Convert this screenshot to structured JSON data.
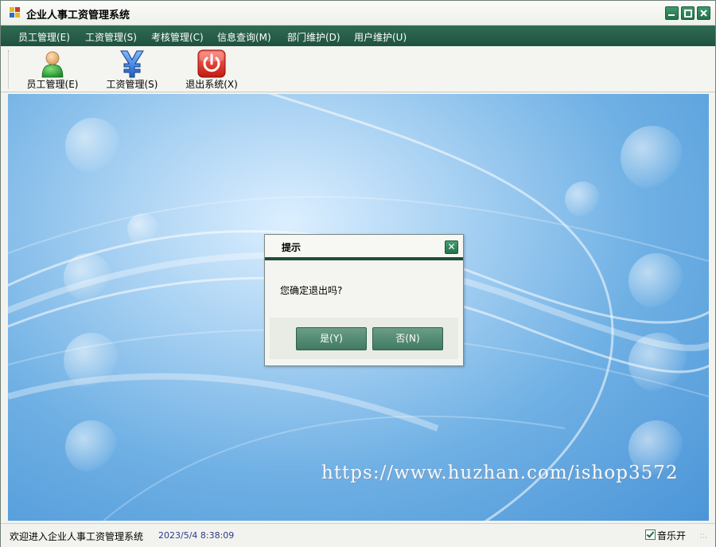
{
  "window": {
    "title": "企业人事工资管理系统"
  },
  "menu": [
    {
      "label": "员工管理(E)"
    },
    {
      "label": "工资管理(S)"
    },
    {
      "label": "考核管理(C)"
    },
    {
      "label": "信息查询(M)"
    },
    {
      "label": "部门维护(D)"
    },
    {
      "label": "用户维护(U)"
    }
  ],
  "toolbar": [
    {
      "label": "员工管理(E)",
      "icon": "person-icon"
    },
    {
      "label": "工资管理(S)",
      "icon": "yen-icon"
    },
    {
      "label": "退出系统(X)",
      "icon": "power-icon"
    }
  ],
  "dialog": {
    "title": "提示",
    "close_glyph": "✕",
    "message": "您确定退出吗?",
    "yes_label": "是(Y)",
    "no_label": "否(N)"
  },
  "watermark": "https://www.huzhan.com/ishop3572",
  "status": {
    "welcome": "欢迎进入企业人事工资管理系统",
    "datetime": "2023/5/4  8:38:09",
    "music_label": "音乐开",
    "music_checked": true
  },
  "colors": {
    "menubar": "#24584a",
    "accent_green": "#3e8a66",
    "background_blue": "#6fb0e4"
  }
}
